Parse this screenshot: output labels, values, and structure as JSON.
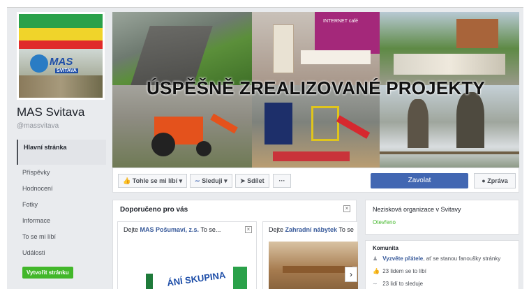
{
  "page": {
    "name": "MAS Svitava",
    "handle": "@massvitava"
  },
  "profile_logo": {
    "brand": "MAS",
    "sub": "SVITAVA"
  },
  "nav": {
    "items": [
      {
        "label": "Hlavní stránka",
        "active": true
      },
      {
        "label": "Příspěvky"
      },
      {
        "label": "Hodnocení"
      },
      {
        "label": "Fotky"
      },
      {
        "label": "Informace"
      },
      {
        "label": "To se mi líbí"
      },
      {
        "label": "Události"
      }
    ]
  },
  "create_page": "Vytvořit stránku",
  "cover": {
    "title": "ÚSPĚŠNĚ ZREALIZOVANÉ PROJEKTY",
    "internet_sign": "INTERNET café"
  },
  "actions": {
    "like": "Tohle se mi líbí",
    "follow": "Sleduji",
    "share": "Sdílet",
    "more": "···",
    "call": "Zavolat",
    "message": "Zpráva"
  },
  "recommended": {
    "title": "Doporučeno pro vás",
    "cards": [
      {
        "prefix": "Dejte",
        "name": "MAS Pošumaví, z.s.",
        "suffix": "To se..."
      },
      {
        "prefix": "Dejte",
        "name": "Zahradní nábytek",
        "suffix": "To se"
      }
    ],
    "card1_image_text": "ÁNÍ SKUPINA"
  },
  "info": {
    "category": "Nezisková organizace v Svitavy",
    "status": "Otevřeno"
  },
  "community": {
    "title": "Komunita",
    "invite_link": "Vyzvěte přátele",
    "invite_text": ", ať se stanou fanoušky stránky",
    "likes": "23 lidem se to líbí",
    "follows": "23 lidí to sleduje"
  },
  "colors": {
    "primary": "#4267b2",
    "green": "#42b72a",
    "link": "#365899"
  }
}
